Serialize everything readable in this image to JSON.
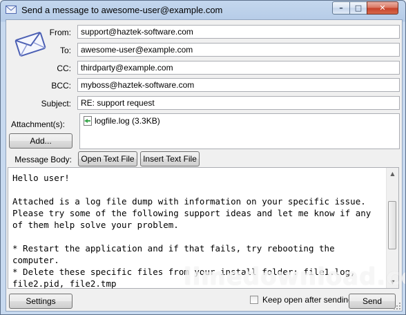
{
  "window": {
    "title": "Send a message to  awesome-user@example.com",
    "controls": {
      "minimize": "–",
      "maximize": "□",
      "close": "✕"
    }
  },
  "icons": {
    "app": "envelope-icon",
    "large": "envelope-icon",
    "attachment": "log-file-icon"
  },
  "form": {
    "from_label": "From:",
    "from_value": "support@haztek-software.com",
    "to_label": "To:",
    "to_value": "awesome-user@example.com",
    "cc_label": "CC:",
    "cc_value": "thirdparty@example.com",
    "bcc_label": "BCC:",
    "bcc_value": "myboss@haztek-software.com",
    "subject_label": "Subject:",
    "subject_value": "RE: support request"
  },
  "attachments": {
    "label": "Attachment(s):",
    "add_button": "Add...",
    "items": [
      {
        "name": "logfile.log (3.3KB)"
      }
    ]
  },
  "body": {
    "label": "Message Body:",
    "open_text_file": "Open Text File",
    "insert_text_file": "Insert Text File",
    "text": "Hello user!\n\nAttached is a log file dump with information on your specific issue. Please try some of the following support ideas and let me know if any of them help solve your problem.\n\n* Restart the application and if that fails, try rebooting the computer.\n* Delete these specific files from your install folder: file1.log, file2.pid, file2.tmp"
  },
  "footer": {
    "settings_button": "Settings",
    "keep_open_label": "Keep open after sending",
    "keep_open_checked": false,
    "send_button": "Send"
  },
  "watermark": "limedownload.com",
  "colors": {
    "title_gradient_top": "#c4d7ee",
    "close_red": "#c7412a",
    "client_bg": "#f0f0f0"
  }
}
